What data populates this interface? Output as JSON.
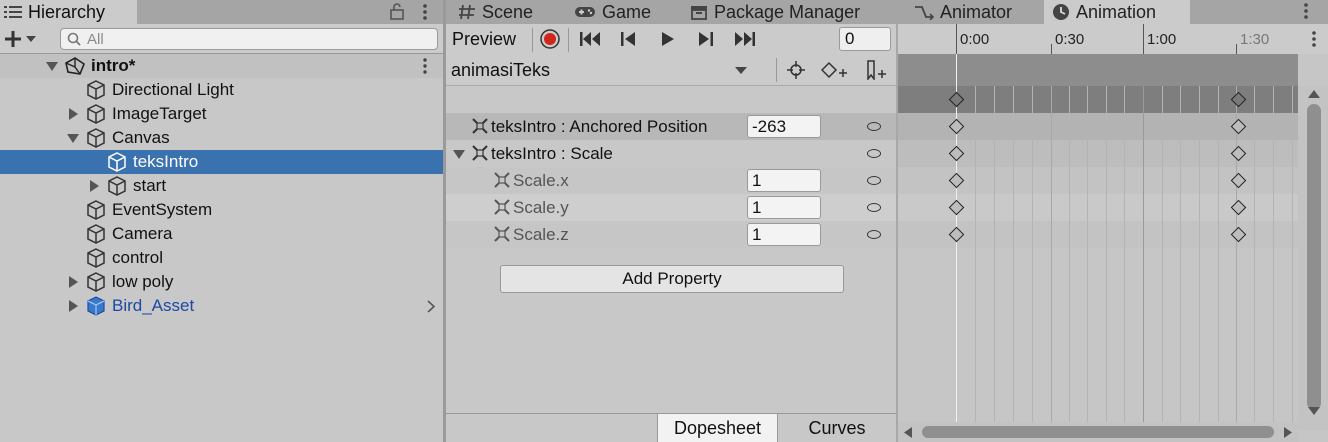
{
  "hierarchy": {
    "tab_label": "Hierarchy",
    "search_placeholder": "All",
    "items": [
      {
        "label": "intro*",
        "indent": 0,
        "type": "scene",
        "expanded": true
      },
      {
        "label": "Directional Light",
        "indent": 1
      },
      {
        "label": "ImageTarget",
        "indent": 1,
        "expandable": true
      },
      {
        "label": "Canvas",
        "indent": 1,
        "expandable": true,
        "expanded": true
      },
      {
        "label": "teksIntro",
        "indent": 2,
        "selected": true
      },
      {
        "label": "start",
        "indent": 2,
        "expandable": true
      },
      {
        "label": "EventSystem",
        "indent": 1
      },
      {
        "label": "Camera",
        "indent": 1
      },
      {
        "label": "control",
        "indent": 1
      },
      {
        "label": "low poly",
        "indent": 1,
        "expandable": true
      },
      {
        "label": "Bird_Asset",
        "indent": 1,
        "expandable": true,
        "prefab": true
      }
    ]
  },
  "tabs": [
    {
      "label": "Scene",
      "icon": "hash-icon"
    },
    {
      "label": "Game",
      "icon": "gamepad-icon"
    },
    {
      "label": "Package Manager",
      "icon": "package-icon"
    },
    {
      "label": "Animator",
      "icon": "animator-icon"
    },
    {
      "label": "Animation",
      "icon": "clock-icon",
      "active": true
    }
  ],
  "animation": {
    "preview_label": "Preview",
    "frame_value": "0",
    "clip_name": "animasiTeks",
    "properties": [
      {
        "name": "teksIntro : Anchored Position",
        "value": "-263",
        "level": 0,
        "collapsed": true
      },
      {
        "name": "teksIntro : Scale",
        "value": "",
        "level": 0,
        "expanded": true
      },
      {
        "name": "Scale.x",
        "value": "1",
        "level": 1
      },
      {
        "name": "Scale.y",
        "value": "1",
        "level": 1
      },
      {
        "name": "Scale.z",
        "value": "1",
        "level": 1
      }
    ],
    "add_property_label": "Add Property",
    "bottom_tabs": [
      {
        "label": "Dopesheet",
        "active": true
      },
      {
        "label": "Curves"
      }
    ]
  },
  "timeline": {
    "ruler_labels": [
      "0:00",
      "0:30",
      "1:00",
      "1:30"
    ]
  },
  "colors": {
    "selection": "#3a72b0",
    "record": "#d0261c",
    "prefab_text": "#1b4aa6"
  }
}
